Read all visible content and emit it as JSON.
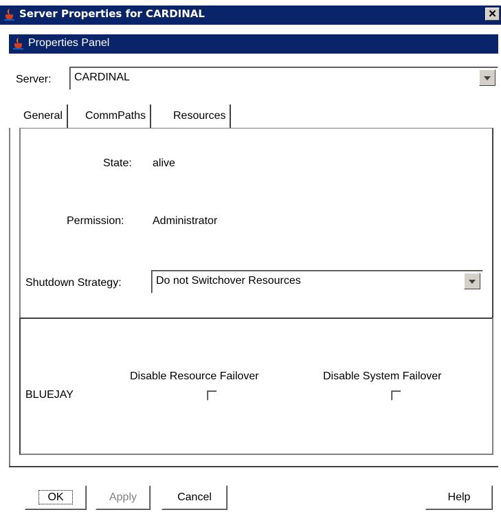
{
  "window": {
    "title": "Server Properties for CARDINAL",
    "close_symbol": "✕"
  },
  "panel": {
    "title": "Properties Panel"
  },
  "server": {
    "label": "Server:",
    "value": "CARDINAL"
  },
  "tabs": [
    {
      "label": "General"
    },
    {
      "label": "CommPaths"
    },
    {
      "label": "Resources"
    }
  ],
  "general": {
    "state_label": "State:",
    "state_value": "alive",
    "permission_label": "Permission:",
    "permission_value": "Administrator",
    "shutdown_label": "Shutdown Strategy:",
    "shutdown_value": "Do not Switchover Resources"
  },
  "failover": {
    "header_resource": "Disable Resource Failover",
    "header_system": "Disable System Failover",
    "rows": [
      {
        "server": "BLUEJAY",
        "resource_failover_disabled": false,
        "system_failover_disabled": false
      }
    ]
  },
  "buttons": {
    "ok": "OK",
    "apply": "Apply",
    "cancel": "Cancel",
    "help": "Help"
  },
  "colors": {
    "titlebar": "#0a246a",
    "face": "#d4d0c8",
    "disabled_text": "#808080"
  }
}
